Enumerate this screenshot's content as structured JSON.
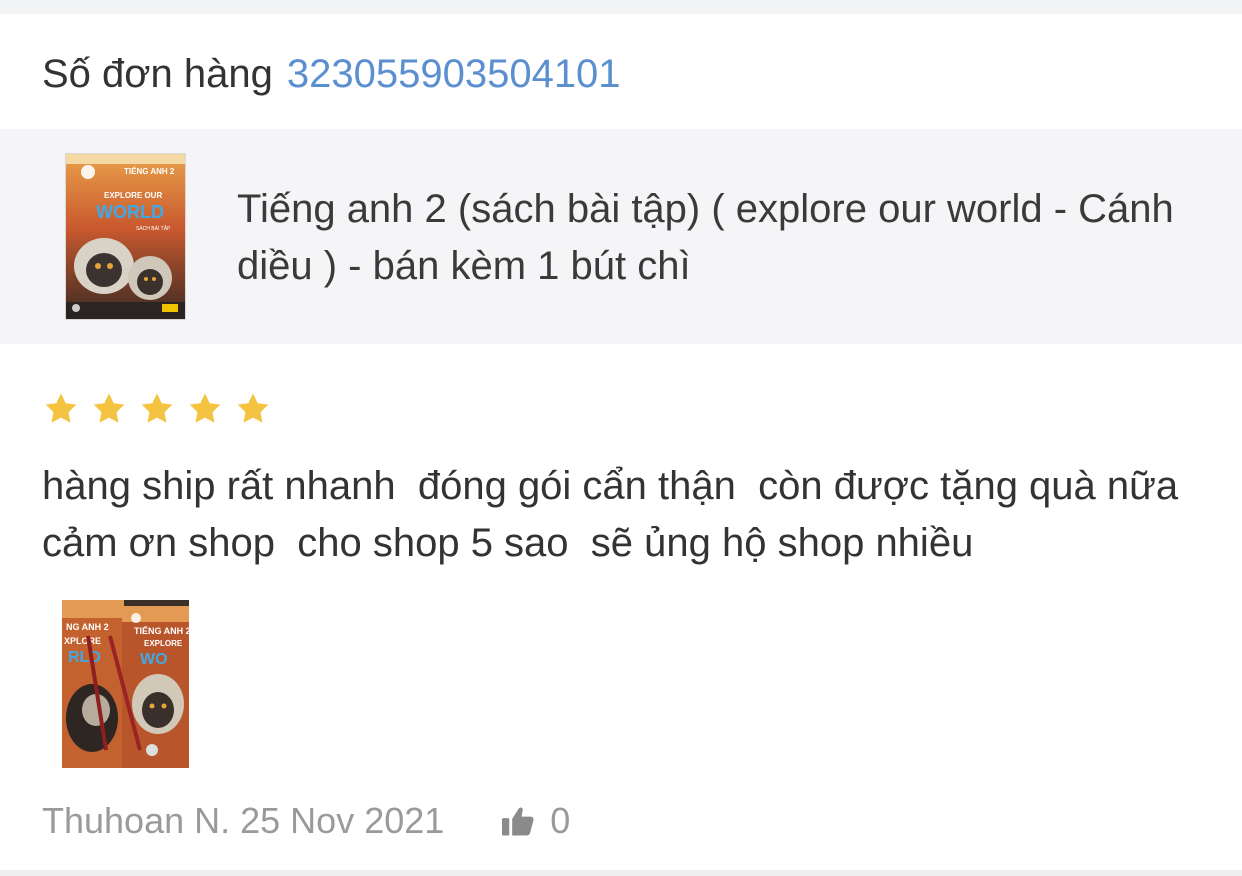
{
  "order": {
    "label": "Số đơn hàng",
    "number": "323055903504101"
  },
  "product": {
    "title": "Tiếng anh 2 (sách bài tập) ( explore our world - Cánh diều ) - bán kèm 1 bút chì",
    "thumb": {
      "title_text": "TIẾNG ANH 2",
      "series_text_1": "EXPLORE OUR",
      "series_text_2": "WORLD",
      "subtitle_text": "SÁCH BÀI TẬP"
    }
  },
  "review": {
    "rating": 5,
    "rating_max": 5,
    "text": "hàng ship rất nhanh  đóng gói cẩn thận  còn được tặng quà nữa  cảm ơn shop  cho shop 5 sao  sẽ ủng hộ shop nhiều",
    "photo": {
      "title_text": "TIẾNG ANH 2",
      "series_text": "EXPLORE"
    },
    "author": "Thuhoan N.",
    "date": "25 Nov 2021",
    "likes": "0"
  },
  "colors": {
    "accent_link": "#5b8fcf",
    "star": "#f5c342",
    "muted_text": "#9a9a9a",
    "product_bg": "#f5f5f7"
  },
  "icons": {
    "star": "star-icon",
    "like": "thumbs-up-icon"
  }
}
